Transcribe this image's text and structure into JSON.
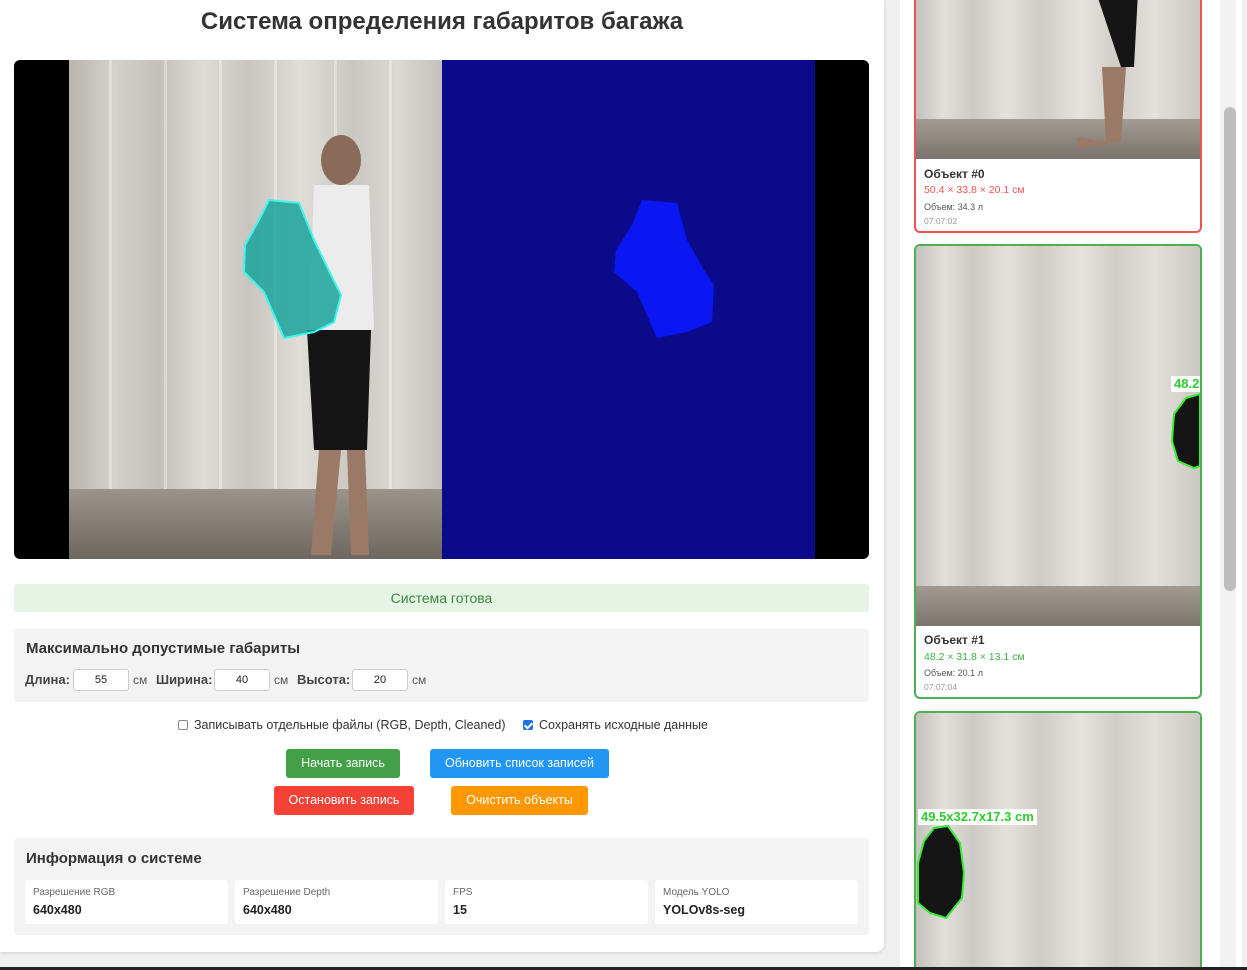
{
  "title": "Система определения габаритов багажа",
  "status": "Система готова",
  "limits": {
    "title": "Максимально допустимые габариты",
    "length_label": "Длина:",
    "length_value": "55",
    "width_label": "Ширина:",
    "width_value": "40",
    "height_label": "Высота:",
    "height_value": "20",
    "unit": "см"
  },
  "options": {
    "separate_files_label": "Записывать отдельные файлы (RGB, Depth, Cleaned)",
    "separate_files_checked": false,
    "save_raw_label": "Сохранять исходные данные",
    "save_raw_checked": true
  },
  "buttons": {
    "start_record": "Начать запись",
    "refresh_records": "Обновить список записей",
    "stop_record": "Остановить запись",
    "clear_objects": "Очистить объекты"
  },
  "colors": {
    "start": "#43a047",
    "refresh": "#2196f3",
    "stop": "#f44336",
    "clear": "#ff9800",
    "ok_green": "#3cb043",
    "bad_red": "#ef5350"
  },
  "system_info": {
    "title": "Информация о системе",
    "items": [
      {
        "label": "Разрешение RGB",
        "value": "640x480"
      },
      {
        "label": "Разрешение Depth",
        "value": "640x480"
      },
      {
        "label": "FPS",
        "value": "15"
      },
      {
        "label": "Модель YOLO",
        "value": "YOLOv8s-seg"
      }
    ]
  },
  "objects": [
    {
      "name": "Объект #0",
      "dims": "50.4 × 33.8 × 20.1 см",
      "volume": "Объем: 34.3 л",
      "time": "07:07:02",
      "status": "exceeds"
    },
    {
      "name": "Объект #1",
      "dims": "48.2 × 31.8 × 13.1 см",
      "volume": "Объем: 20.1 л",
      "time": "07:07:04",
      "status": "ok",
      "tag": "48.2"
    },
    {
      "name": "",
      "dims": "",
      "volume": "",
      "time": "",
      "status": "ok",
      "tag": "49.5x32.7x17.3 cm"
    }
  ]
}
